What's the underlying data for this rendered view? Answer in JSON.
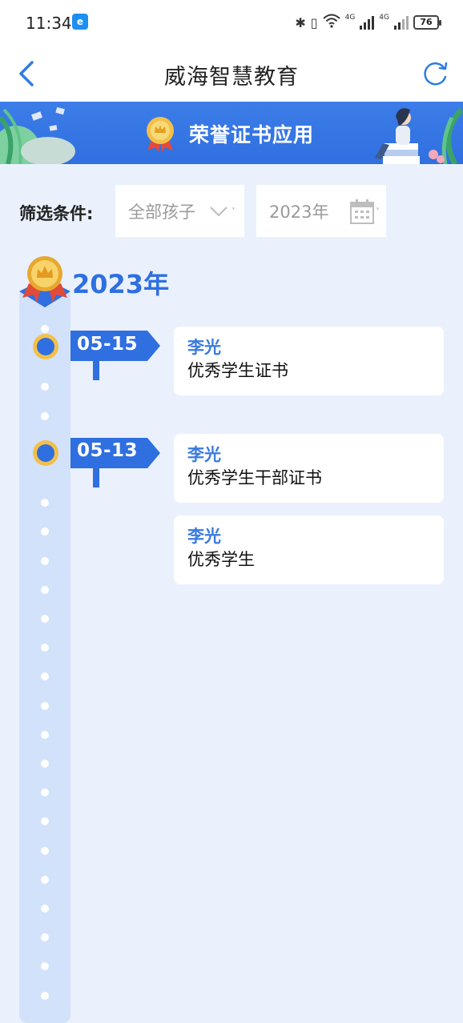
{
  "status_bar": {
    "time": "11:34",
    "battery": "76",
    "network_tag_1": "4G",
    "network_tag_2": "4G"
  },
  "nav": {
    "title": "威海智慧教育"
  },
  "banner": {
    "title": "荣誉证书应用"
  },
  "filter": {
    "label": "筛选条件:",
    "child_value": "全部孩子",
    "year_value": "2023年"
  },
  "timeline": {
    "year": "2023年",
    "groups": [
      {
        "date": "05-15",
        "items": [
          {
            "name": "李光",
            "title": "优秀学生证书"
          }
        ]
      },
      {
        "date": "05-13",
        "items": [
          {
            "name": "李光",
            "title": "优秀学生干部证书"
          },
          {
            "name": "李光",
            "title": "优秀学生"
          }
        ]
      }
    ]
  },
  "colors": {
    "accent": "#2f6fe0",
    "background": "#eaf1fd",
    "medal": "#f2c04a",
    "track": "#d3e2fb"
  }
}
